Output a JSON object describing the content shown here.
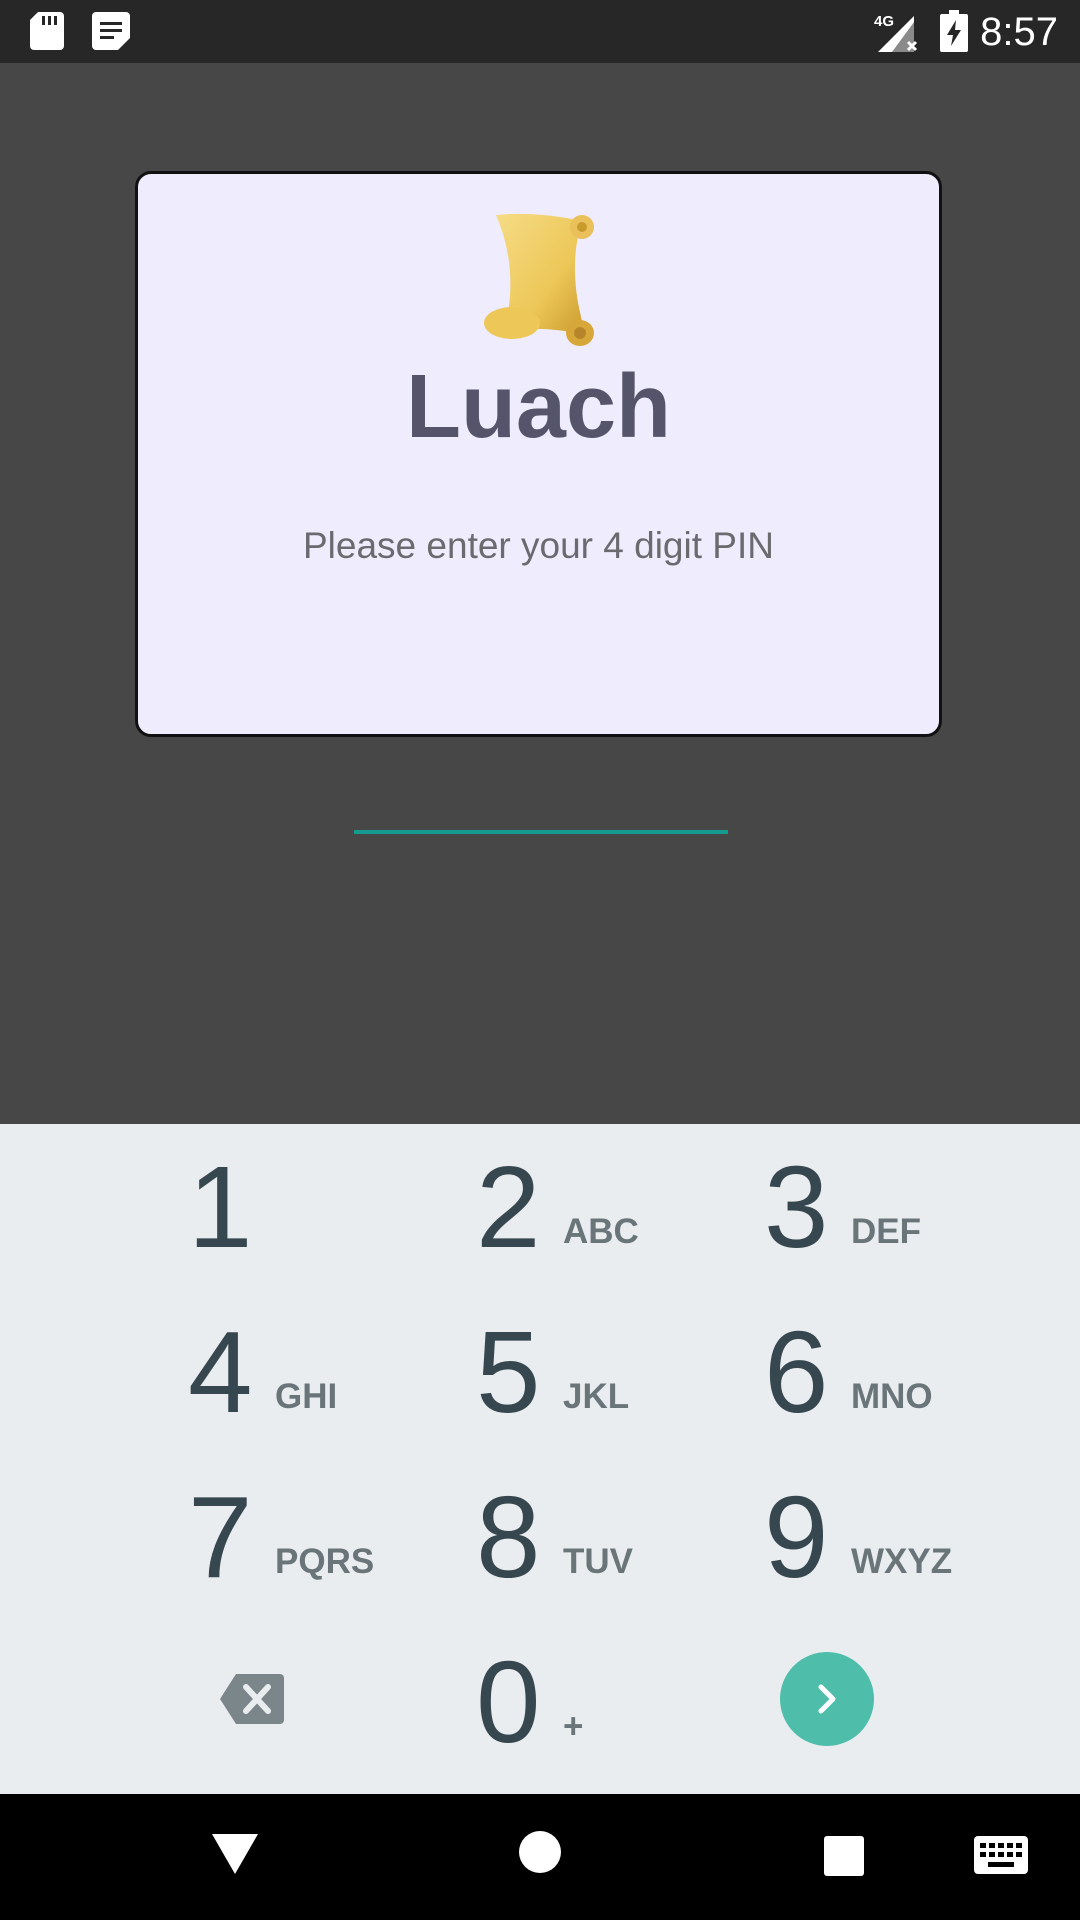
{
  "status_bar": {
    "time": "8:57",
    "network_label": "4G",
    "icons": [
      "sd-card-icon",
      "notes-icon",
      "signal-no-data-icon",
      "battery-charging-icon"
    ]
  },
  "dialog": {
    "logo_icon": "scroll-icon",
    "title": "Luach",
    "prompt": "Please enter your 4 digit PIN",
    "pin_value": "",
    "accent_color": "#159a8f"
  },
  "keypad": {
    "keys": [
      {
        "digit": "1",
        "letters": ""
      },
      {
        "digit": "2",
        "letters": "ABC"
      },
      {
        "digit": "3",
        "letters": "DEF"
      },
      {
        "digit": "4",
        "letters": "GHI"
      },
      {
        "digit": "5",
        "letters": "JKL"
      },
      {
        "digit": "6",
        "letters": "MNO"
      },
      {
        "digit": "7",
        "letters": "PQRS"
      },
      {
        "digit": "8",
        "letters": "TUV"
      },
      {
        "digit": "9",
        "letters": "WXYZ"
      },
      {
        "digit": "0",
        "letters": "+"
      }
    ],
    "backspace_icon": "backspace-icon",
    "next_icon": "chevron-right-icon",
    "next_color": "#4ebdaa"
  },
  "nav_bar": {
    "icons": [
      "back-icon",
      "home-icon",
      "recents-icon",
      "keyboard-icon"
    ]
  }
}
